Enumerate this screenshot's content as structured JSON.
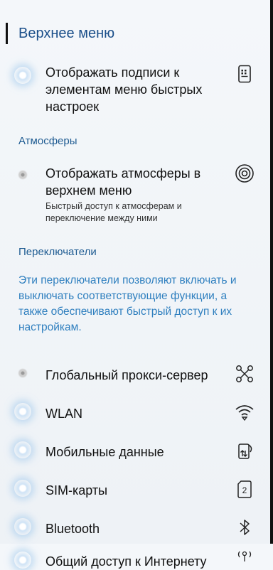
{
  "header": {
    "title": "Верхнее меню"
  },
  "items_top": [
    {
      "label_lines": [
        "Отображать подписи к",
        "элементам меню быстрых",
        "настроек"
      ],
      "icon": "labels-icon"
    }
  ],
  "sections": {
    "atmospheres": "Атмосферы",
    "switches": "Переключатели"
  },
  "atmosphere_item": {
    "label_lines": [
      "Отображать атмосферы в",
      "верхнем меню"
    ],
    "sub_lines": [
      "Быстрый доступ к атмосферам и",
      "переключение между ними"
    ],
    "icon": "atmosphere-icon"
  },
  "switches_desc_lines": [
    "Эти переключатели позволяют включать и",
    "выключать соответствующие функции, а",
    "также обеспечивают быстрый доступ к их",
    "настройкам."
  ],
  "switch_items": [
    {
      "label": "Глобальный прокси-сервер",
      "icon": "proxy-icon",
      "state": "off"
    },
    {
      "label": "WLAN",
      "icon": "wifi-icon",
      "state": "on"
    },
    {
      "label": "Мобильные данные",
      "icon": "mobile-data-icon",
      "state": "on"
    },
    {
      "label": "SIM-карты",
      "icon": "sim-icon",
      "state": "on",
      "icon_text": "2"
    },
    {
      "label": "Bluetooth",
      "icon": "bluetooth-icon",
      "state": "on"
    },
    {
      "label": "Общий доступ к Интернету",
      "icon": "hotspot-icon",
      "state": "on"
    }
  ]
}
